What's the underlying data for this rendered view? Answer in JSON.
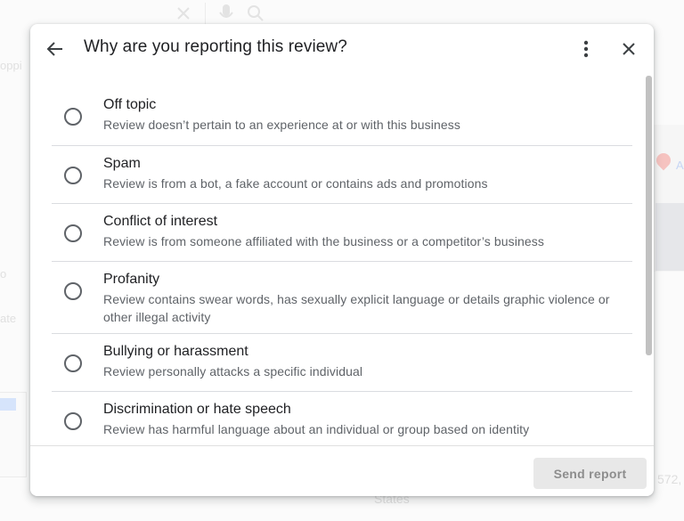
{
  "background": {
    "left_fragments": [
      "oppi",
      "o",
      "ate"
    ],
    "bottom_fragments": [
      "States",
      "572,"
    ],
    "map_label": "A"
  },
  "dialog": {
    "title": "Why are you reporting this review?",
    "back_icon": "arrow-back-icon",
    "more_icon": "more-vert-icon",
    "close_icon": "close-icon",
    "options": [
      {
        "title": "Off topic",
        "description": "Review doesn’t pertain to an experience at or with this business",
        "selected": false
      },
      {
        "title": "Spam",
        "description": "Review is from a bot, a fake account or contains ads and promotions",
        "selected": false
      },
      {
        "title": "Conflict of interest",
        "description": "Review is from someone affiliated with the business or a competitor’s business",
        "selected": false
      },
      {
        "title": "Profanity",
        "description": "Review contains swear words, has sexually explicit language or details graphic violence or other illegal activity",
        "selected": false
      },
      {
        "title": "Bullying or harassment",
        "description": "Review personally attacks a specific individual",
        "selected": false
      },
      {
        "title": "Discrimination or hate speech",
        "description": "Review has harmful language about an individual or group based on identity",
        "selected": false
      }
    ],
    "send_button": {
      "label": "Send report",
      "enabled": false
    }
  },
  "colors": {
    "text_primary": "#202124",
    "text_secondary": "#5f6368",
    "divider": "#dadce0",
    "disabled_button_bg": "#e8e8e8",
    "disabled_button_text": "#8d8d8d"
  }
}
